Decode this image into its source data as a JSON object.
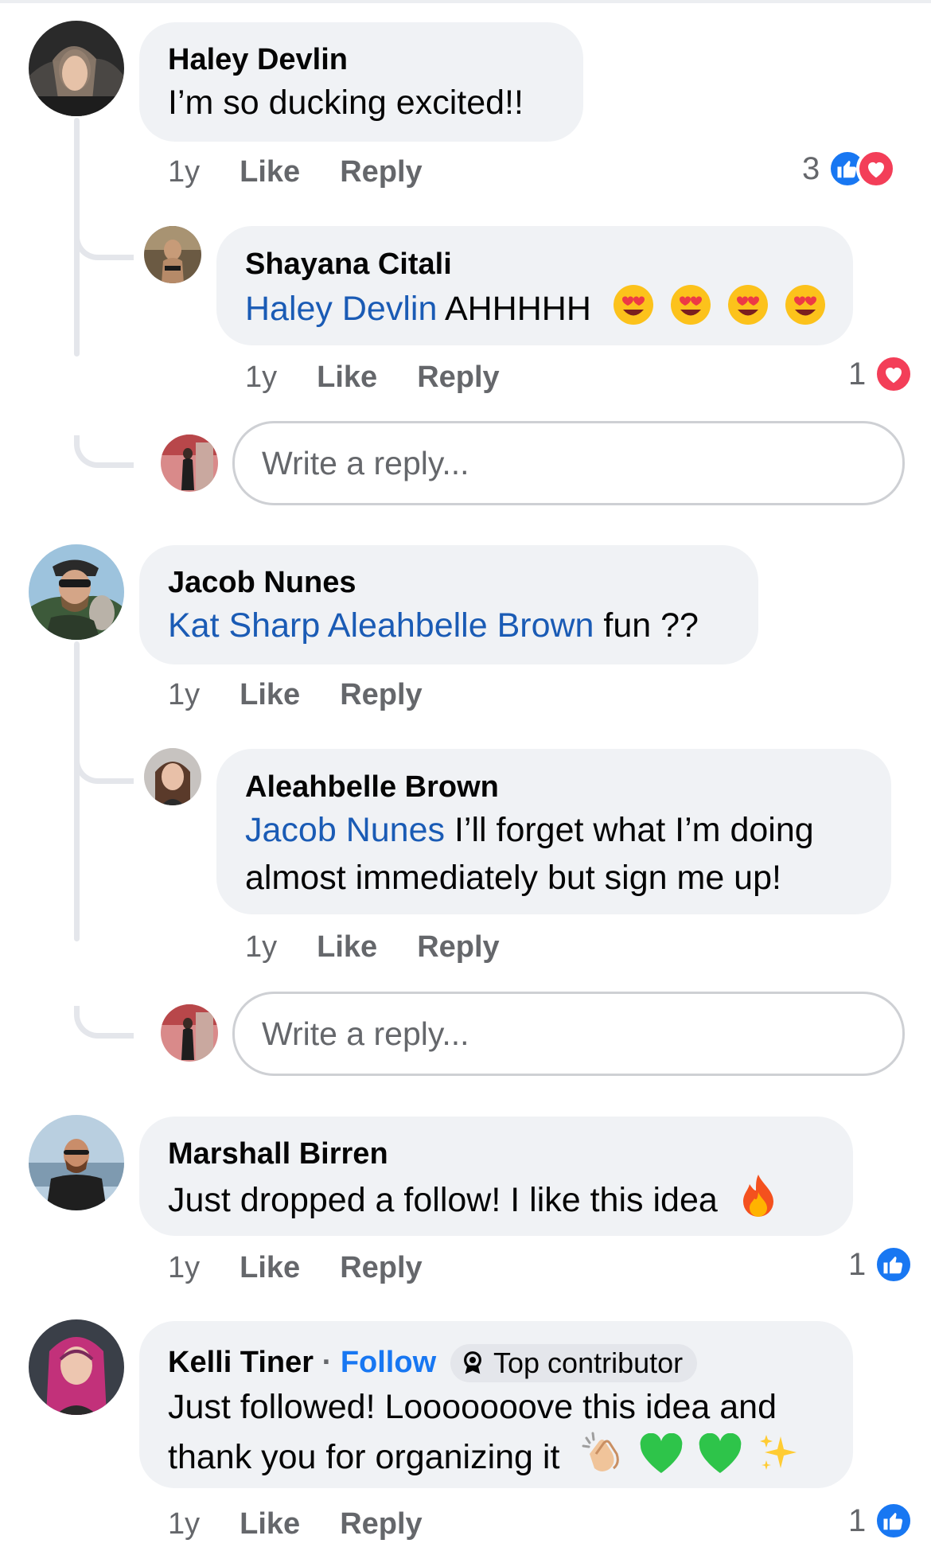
{
  "comments": [
    {
      "author": "Haley Devlin",
      "text": "I’m so ducking excited!!",
      "time": "1y",
      "like_label": "Like",
      "reply_label": "Reply",
      "reaction_count": "3",
      "reactions": [
        "like",
        "love"
      ]
    },
    {
      "author": "Shayana Citali",
      "mention": "Haley Devlin",
      "text": "AHHHHH",
      "emojis": [
        "heart-eyes",
        "heart-eyes",
        "heart-eyes",
        "heart-eyes"
      ],
      "time": "1y",
      "like_label": "Like",
      "reply_label": "Reply",
      "reaction_count": "1",
      "reactions": [
        "love"
      ]
    },
    {
      "author": "Jacob Nunes",
      "mention": "Kat Sharp Aleahbelle Brown",
      "text": "fun ??",
      "time": "1y",
      "like_label": "Like",
      "reply_label": "Reply"
    },
    {
      "author": "Aleahbelle Brown",
      "mention": "Jacob Nunes",
      "text_line1": "I’ll forget what I’m doing",
      "text_line2": "almost immediately but sign me up!",
      "time": "1y",
      "like_label": "Like",
      "reply_label": "Reply"
    },
    {
      "author": "Marshall Birren",
      "text": "Just dropped a follow! I like this idea",
      "emojis": [
        "fire"
      ],
      "time": "1y",
      "like_label": "Like",
      "reply_label": "Reply",
      "reaction_count": "1",
      "reactions": [
        "like"
      ]
    },
    {
      "author": "Kelli Tiner",
      "separator": "·",
      "follow_label": "Follow",
      "badge": "Top contributor",
      "text_line1": "Just followed! Looooooove this idea and",
      "text_line2": "thank you for organizing it",
      "emojis": [
        "clapping-hands",
        "green-heart",
        "green-heart",
        "sparkles"
      ],
      "time": "1y",
      "like_label": "Like",
      "reply_label": "Reply",
      "reaction_count": "1",
      "reactions": [
        "like"
      ]
    }
  ],
  "reply_box": {
    "placeholder": "Write a reply..."
  },
  "colors": {
    "bubble": "#f0f2f5",
    "mention": "#1a5bb5",
    "meta_text": "#65676b",
    "like_blue": "#1877f2",
    "love_red": "#f33e58",
    "thread_line": "#e4e6eb"
  }
}
